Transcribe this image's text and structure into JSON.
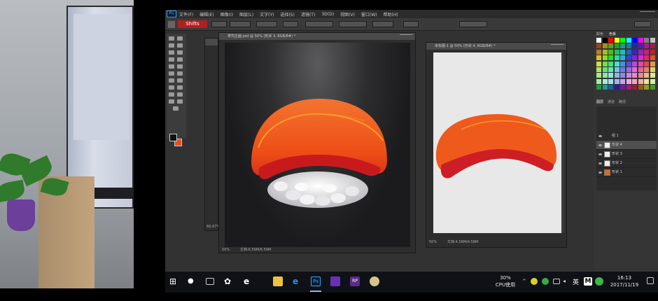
{
  "photoshop": {
    "menu_items": [
      "文件(F)",
      "编辑(E)",
      "图像(I)",
      "图层(L)",
      "文字(Y)",
      "选择(S)",
      "滤镜(T)",
      "3D(D)",
      "视图(V)",
      "窗口(W)",
      "帮助(H)"
    ],
    "option_tag": "Shifts",
    "doc1_title": "寿司正面.psd @ 50% (形状 3, RGB/8#) *",
    "doc1_status_zoom": "50%",
    "doc1_status_file": "文档:6.59M/6.59M",
    "doc2_title": "未标题-1 @ 50% (形状 4, RGB/8#) *",
    "doc2_status_zoom": "50%",
    "doc2_status_file": "文档:4.58M/4.58M",
    "doc0_status": "66.67%",
    "panel_tab_color": "颜色",
    "panel_tab_swatches": "色板",
    "layers_tabs": [
      "图层",
      "通道",
      "路径"
    ],
    "layers": [
      {
        "name": "组 1",
        "selected": false
      },
      {
        "name": "形状 4",
        "selected": true
      },
      {
        "name": "形状 3",
        "selected": false
      },
      {
        "name": "形状 2",
        "selected": false
      },
      {
        "name": "形状 1",
        "selected": false
      }
    ]
  },
  "taskbar": {
    "cpu_percent": "30%",
    "cpu_label": "CPU使用",
    "ime": "英",
    "time": "16:13",
    "date": "2017/11/19"
  },
  "colors": {
    "salmon_top": "#f0561a",
    "salmon_stripe": "#f7a02a",
    "salmon_under": "#d31b1b",
    "rice": "#e6e6e6",
    "ps_blue": "#31a8ff"
  }
}
